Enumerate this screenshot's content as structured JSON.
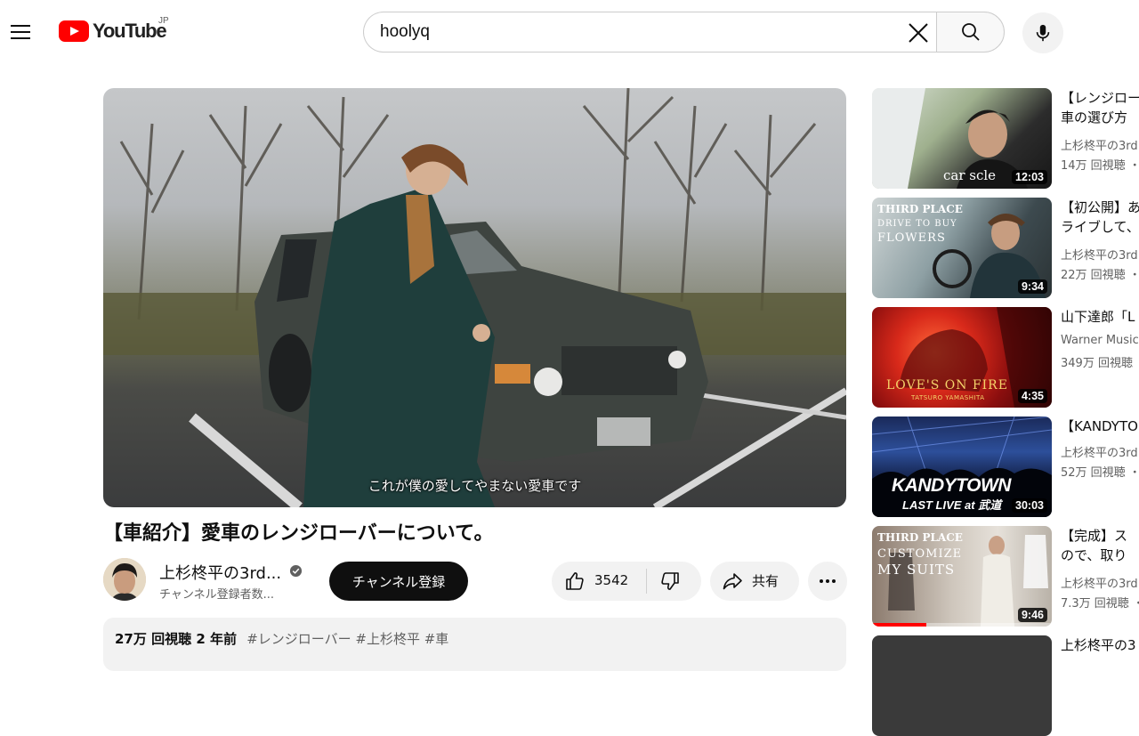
{
  "masthead": {
    "logo_text": "YouTube",
    "region": "JP",
    "search_value": "hoolyq"
  },
  "player": {
    "caption": "これが僕の愛してやまない愛車です"
  },
  "video": {
    "title": "【車紹介】愛車のレンジローバーについて。",
    "channel": "上杉柊平の3rd...",
    "subscribers": "チャンネル登録者数...",
    "subscribe_label": "チャンネル登録",
    "likes": "3542",
    "share_label": "共有",
    "description_meta": "27万 回視聴  2 年前",
    "description_tags": "#レンジローバー #上杉柊平 #車"
  },
  "recommendations": [
    {
      "title_1": "【レンジロー",
      "title_2": "車の選び方",
      "channel": "上杉柊平の3rd",
      "views": "14万 回視聴 ・",
      "duration": "12:03",
      "thumb_caption": "car scle"
    },
    {
      "title_1": "【初公開】あ",
      "title_2": "ライブして、",
      "channel": "上杉柊平の3rd",
      "views": "22万 回視聴 ・",
      "duration": "9:34",
      "thumb_line_1": "THIRD PLACE",
      "thumb_line_2": "DRIVE TO BUY",
      "thumb_line_3": "FLOWERS"
    },
    {
      "title_1": "山下達郎「L",
      "title_2": "",
      "channel": "Warner Music",
      "views": "349万 回視聴",
      "duration": "4:35",
      "thumb_line_1": "LOVE'S ON FIRE",
      "thumb_line_2": "TATSURO YAMASHITA"
    },
    {
      "title_1": "【KANDYTO",
      "title_2": "",
      "channel": "上杉柊平の3rd",
      "views": "52万 回視聴 ・",
      "duration": "30:03",
      "thumb_line_1": "KANDYTOWN",
      "thumb_line_2": "LAST LIVE at 武道"
    },
    {
      "title_1": "【完成】ス",
      "title_2": "ので、取り",
      "channel": "上杉柊平の3rd",
      "views": "7.3万 回視聴 ・",
      "duration": "9:46",
      "thumb_line_1": "THIRD PLACE",
      "thumb_line_2": "CUSTOMIZE",
      "thumb_line_3": "MY SUITS"
    },
    {
      "title_1": "上杉柊平の3",
      "title_2": "",
      "channel": "",
      "views": "",
      "duration": ""
    }
  ]
}
